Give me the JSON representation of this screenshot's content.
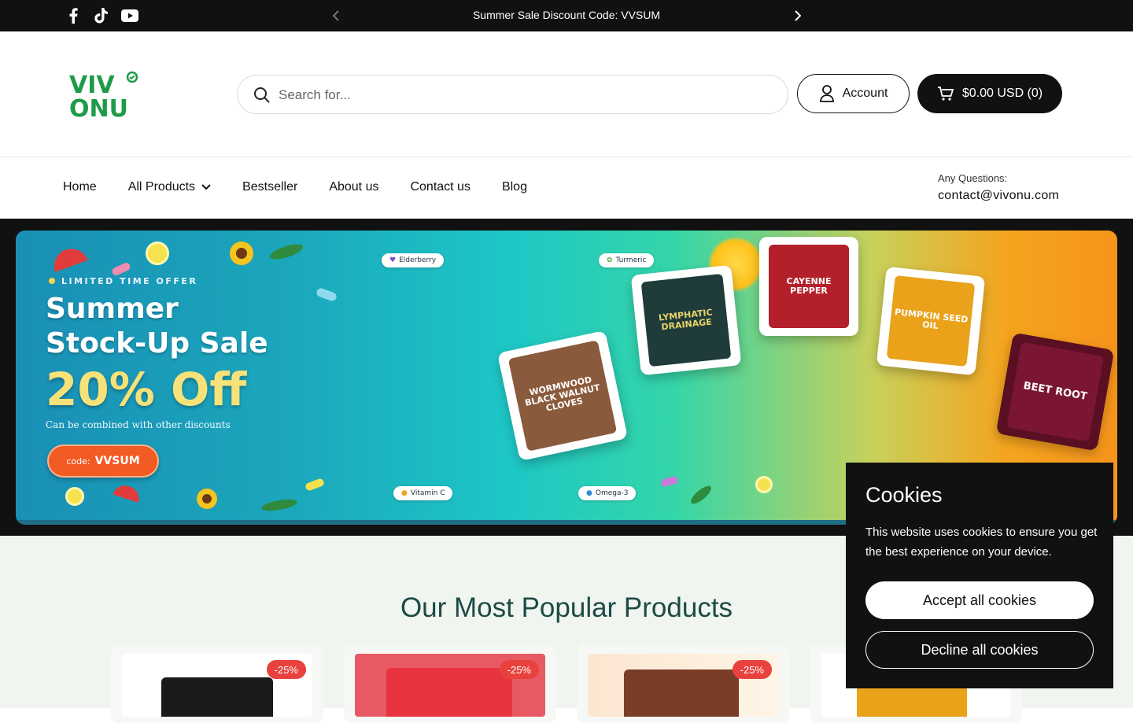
{
  "announcement": {
    "text": "Summer Sale Discount Code: VVSUM",
    "social_icons": [
      "facebook-icon",
      "tiktok-icon",
      "youtube-icon"
    ]
  },
  "header": {
    "logo_text_top": "VIV",
    "logo_text_bottom": "ONU",
    "search_placeholder": "Search for...",
    "account_label": "Account",
    "cart_label": "$0.00 USD (0)"
  },
  "nav": {
    "items": [
      {
        "label": "Home"
      },
      {
        "label": "All Products"
      },
      {
        "label": "Bestseller"
      },
      {
        "label": "About us"
      },
      {
        "label": "Contact us"
      },
      {
        "label": "Blog"
      }
    ],
    "contact_label": "Any Questions:",
    "contact_email": "contact@vivonu.com"
  },
  "hero": {
    "kicker": "LIMITED TIME OFFER",
    "headline_1": "Summer",
    "headline_2": "Stock-Up Sale",
    "offer": "20% Off",
    "subtext": "Can be combined with other discounts",
    "code_prefix": "code:",
    "code": "VVSUM",
    "pills": [
      "Elderberry",
      "Turmeric",
      "Vitamin C",
      "Omega-3"
    ],
    "products": [
      {
        "name": "WORMWOOD BLACK WALNUT CLOVES",
        "color": "#8a5a3c"
      },
      {
        "name": "LYMPHATIC DRAINAGE",
        "color": "#1f3b3a"
      },
      {
        "name": "CAYENNE PEPPER",
        "color": "#b3202b"
      },
      {
        "name": "PUMPKIN SEED OIL",
        "color": "#e9a21a"
      },
      {
        "name": "BEET ROOT",
        "color": "#7a1634"
      }
    ]
  },
  "popular": {
    "title": "Our Most Popular Products",
    "cards": [
      {
        "badge": "-25%",
        "color": "#1a1a1a"
      },
      {
        "badge": "-25%",
        "color": "#e8343f"
      },
      {
        "badge": "-25%",
        "color": "#7a3d28"
      },
      {
        "badge": "",
        "color": "#e9a21a"
      }
    ]
  },
  "cookies": {
    "title": "Cookies",
    "body": "This website uses cookies to ensure you get the best experience on your device.",
    "accept": "Accept all cookies",
    "decline": "Decline all cookies"
  }
}
